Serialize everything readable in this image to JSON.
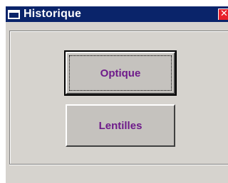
{
  "window": {
    "title": "Historique",
    "close_symbol": "✕",
    "icon": "window-icon"
  },
  "buttons": {
    "optique_label": "Optique",
    "lentilles_label": "Lentilles"
  },
  "colors": {
    "titlebar": "#0a246a",
    "window_face": "#d6d3ce",
    "button_face": "#c5c2be",
    "button_text": "#6e1a8a",
    "close_button": "#e8202a"
  }
}
